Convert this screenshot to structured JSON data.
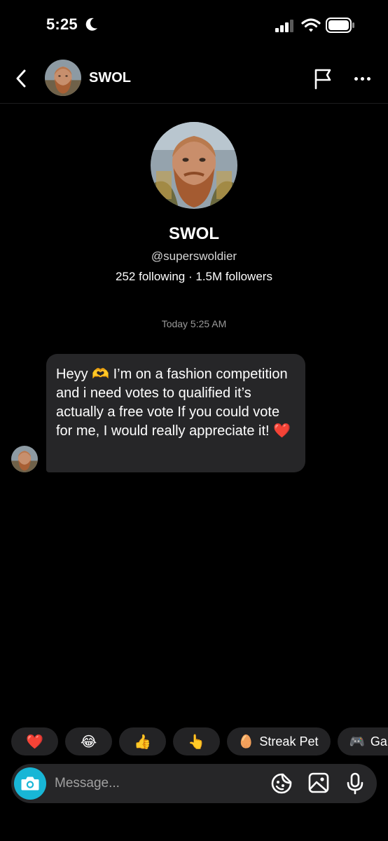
{
  "status_bar": {
    "time": "5:25"
  },
  "header": {
    "name": "SWOL"
  },
  "profile": {
    "name": "SWOL",
    "handle": "@superswoldier",
    "stats": "252 following · 1.5M followers"
  },
  "thread": {
    "timestamp": "Today 5:25 AM",
    "message": {
      "text_before_emoji": "Heyy ",
      "emoji_1": "🫶",
      "text_after_emoji": " I’m on a fashion competition and i need votes to qualified it’s actually a free vote If you could vote for me, I would really appreciate it! ",
      "emoji_2": "❤️"
    }
  },
  "quick_reactions": [
    {
      "glyph": "❤️",
      "name": "heart"
    },
    {
      "glyph": "😂",
      "name": "laughing"
    },
    {
      "glyph": "👍",
      "name": "thumbs-up"
    },
    {
      "glyph": "👆",
      "name": "pointing-up"
    }
  ],
  "quick_actions": [
    {
      "glyph": "🥚",
      "label": "Streak Pet"
    },
    {
      "glyph": "🎮",
      "label": "Gar"
    }
  ],
  "composer": {
    "placeholder": "Message..."
  },
  "colors": {
    "background": "#000000",
    "bubble": "#262628",
    "accent": "#18b6d6",
    "heart": "#e0243b"
  }
}
